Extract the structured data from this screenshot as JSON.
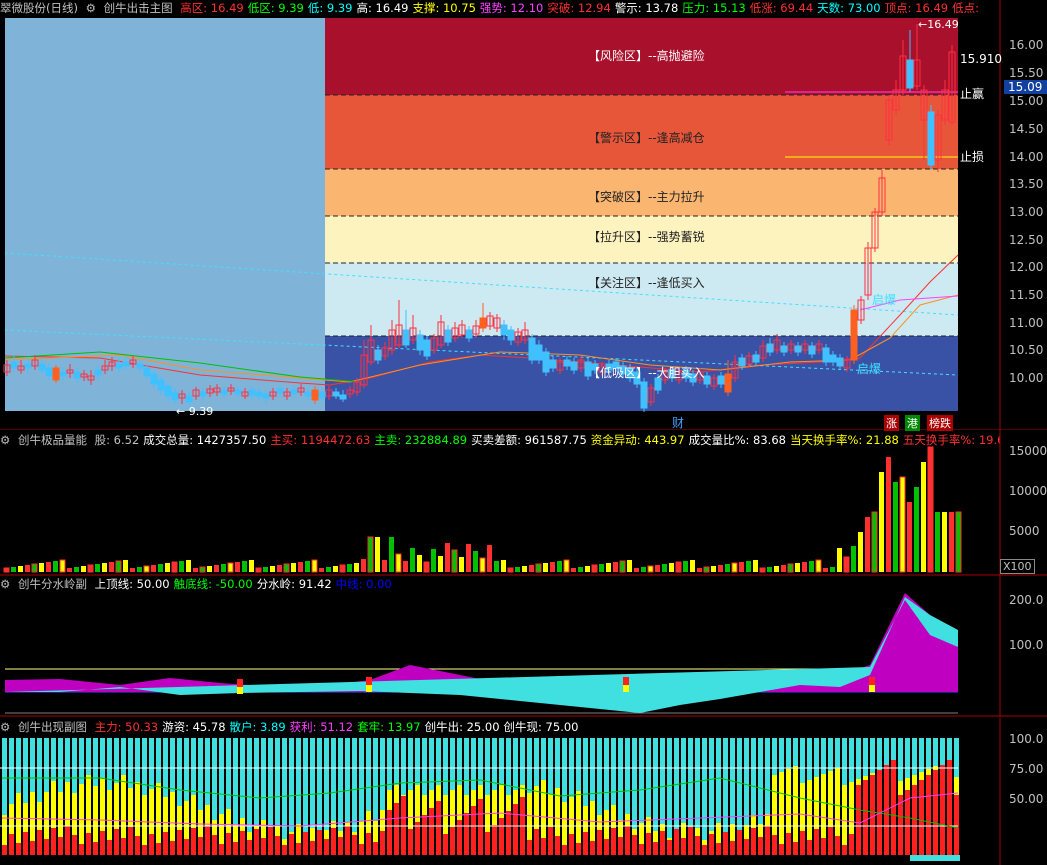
{
  "main": {
    "stock": "翠微股份(日线)",
    "indicator": "创牛出击主图",
    "items": [
      {
        "k": "高区:",
        "v": "16.49",
        "color": "#ff3030"
      },
      {
        "k": "低区:",
        "v": "9.39",
        "color": "#00ff00"
      },
      {
        "k": "低:",
        "v": "9.39",
        "color": "#00ffff"
      },
      {
        "k": "高:",
        "v": "16.49",
        "color": "#ffffff"
      },
      {
        "k": "支撑:",
        "v": "10.75",
        "color": "#ffff00"
      },
      {
        "k": "强势:",
        "v": "12.10",
        "color": "#ff40ff"
      },
      {
        "k": "突破:",
        "v": "12.94",
        "color": "#ff3030"
      },
      {
        "k": "警示:",
        "v": "13.78",
        "color": "#ffffff"
      },
      {
        "k": "压力:",
        "v": "15.13",
        "color": "#00ff00"
      },
      {
        "k": "低涨:",
        "v": "69.44",
        "color": "#ff3030"
      },
      {
        "k": "天数:",
        "v": "73.00",
        "color": "#00ffff"
      },
      {
        "k": "顶点:",
        "v": "16.49",
        "color": "#ff3030"
      },
      {
        "k": "低点:",
        "v": "",
        "color": "#ff3030"
      }
    ],
    "zones": [
      {
        "label": "【风险区】--高抛避险",
        "color": "#a8102c"
      },
      {
        "label": "【警示区】--逢高减仓",
        "color": "#e8563a"
      },
      {
        "label": "【突破区】--主力拉升",
        "color": "#fab570"
      },
      {
        "label": "【拉升区】--强势蓄锐",
        "color": "#fcf3bf"
      },
      {
        "label": "【关注区】--逢低买入",
        "color": "#cde9f2"
      },
      {
        "label": "【低吸区】--大胆买入",
        "color": "#3a52a6"
      }
    ],
    "high_mark": "16.49",
    "low_mark": "9.39",
    "price_tag": "15.910",
    "current_price": "15.09",
    "take_profit": "止赢",
    "stop_loss": "止损",
    "launch1": "启爆",
    "launch2": "启爆",
    "finance": "财",
    "tags": [
      "涨",
      "港",
      "榜跌"
    ],
    "yaxis": [
      "16.00",
      "15.50",
      "15.00",
      "14.50",
      "14.00",
      "13.50",
      "13.00",
      "12.50",
      "12.00",
      "11.50",
      "11.00",
      "10.50",
      "10.00"
    ]
  },
  "vol": {
    "indicator": "创牛极品量能",
    "items": [
      {
        "k": "股:",
        "v": "6.52",
        "color": "#c0c0c0"
      },
      {
        "k": "成交总量:",
        "v": "1427357.50",
        "color": "#ffffff"
      },
      {
        "k": "主买:",
        "v": "1194472.63",
        "color": "#ff3030"
      },
      {
        "k": "主卖:",
        "v": "232884.89",
        "color": "#00ff00"
      },
      {
        "k": "买卖差额:",
        "v": "961587.75",
        "color": "#ffffff"
      },
      {
        "k": "资金异动:",
        "v": "443.97",
        "color": "#ffff00"
      },
      {
        "k": "成交量比%:",
        "v": "83.68",
        "color": "#ffffff"
      },
      {
        "k": "当天换手率%:",
        "v": "21.88",
        "color": "#ffff00"
      },
      {
        "k": "五天换手率%:",
        "v": "19.6",
        "color": "#ff3030"
      }
    ],
    "yaxis": [
      "15000",
      "10000",
      "5000"
    ],
    "unit": "X100"
  },
  "water": {
    "indicator": "创牛分水岭副",
    "items": [
      {
        "k": "上顶线:",
        "v": "50.00",
        "color": "#ffffff"
      },
      {
        "k": "触底线:",
        "v": "-50.00",
        "color": "#00ff00"
      },
      {
        "k": "分水岭:",
        "v": "91.42",
        "color": "#ffffff"
      },
      {
        "k": "中线:",
        "v": "0.00",
        "color": "#0000ff"
      }
    ],
    "yaxis": [
      "200.0",
      "100.0"
    ]
  },
  "cx": {
    "indicator": "创牛出现副图",
    "items": [
      {
        "k": "主力:",
        "v": "50.33",
        "color": "#ff3030"
      },
      {
        "k": "游资:",
        "v": "45.78",
        "color": "#ffffff"
      },
      {
        "k": "散户:",
        "v": "3.89",
        "color": "#00ffff"
      },
      {
        "k": "获利:",
        "v": "51.12",
        "color": "#ff40ff"
      },
      {
        "k": "套牢:",
        "v": "13.97",
        "color": "#00ff00"
      },
      {
        "k": "创牛出:",
        "v": "25.00",
        "color": "#ffffff"
      },
      {
        "k": "创牛现:",
        "v": "75.00",
        "color": "#ffffff"
      }
    ],
    "yaxis": [
      "100.0",
      "75.00",
      "50.00"
    ]
  }
}
